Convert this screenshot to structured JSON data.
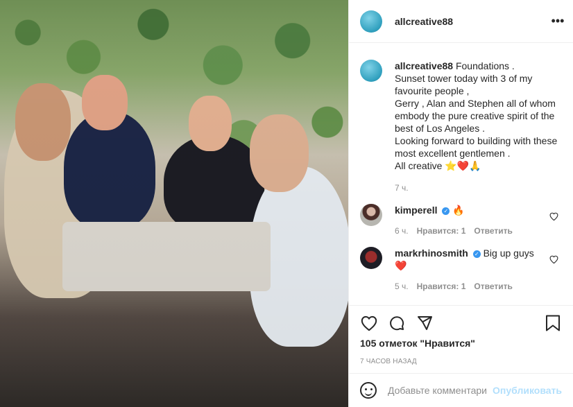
{
  "post": {
    "username": "allcreative88",
    "caption_lines": [
      "Foundations .",
      "Sunset tower today with 3 of my favourite people ,",
      "Gerry , Alan and Stephen all of whom embody the pure creative spirit of the best of Los Angeles .",
      "Looking forward to building with these most excellent gentlemen .",
      "All creative ⭐❤️🙏"
    ],
    "time_ago": "7 ч.",
    "likes": "105 отметок \"Нравится\"",
    "posted": "7 ЧАСОВ НАЗАД"
  },
  "comments": [
    {
      "username": "kimperell",
      "text": "🔥",
      "time": "6 ч.",
      "likes": "Нравится: 1",
      "reply": "Ответить"
    },
    {
      "username": "markrhinosmith",
      "text": "Big up guys ❤️",
      "time": "5 ч.",
      "likes": "Нравится: 1",
      "reply": "Ответить"
    }
  ],
  "composer": {
    "placeholder": "Добавьте комментарий...",
    "publish": "Опубликовать"
  },
  "icons": {
    "more": "more-icon",
    "like": "heart-icon",
    "comment": "comment-icon",
    "share": "share-icon",
    "save": "bookmark-icon",
    "emoji": "emoji-icon"
  }
}
